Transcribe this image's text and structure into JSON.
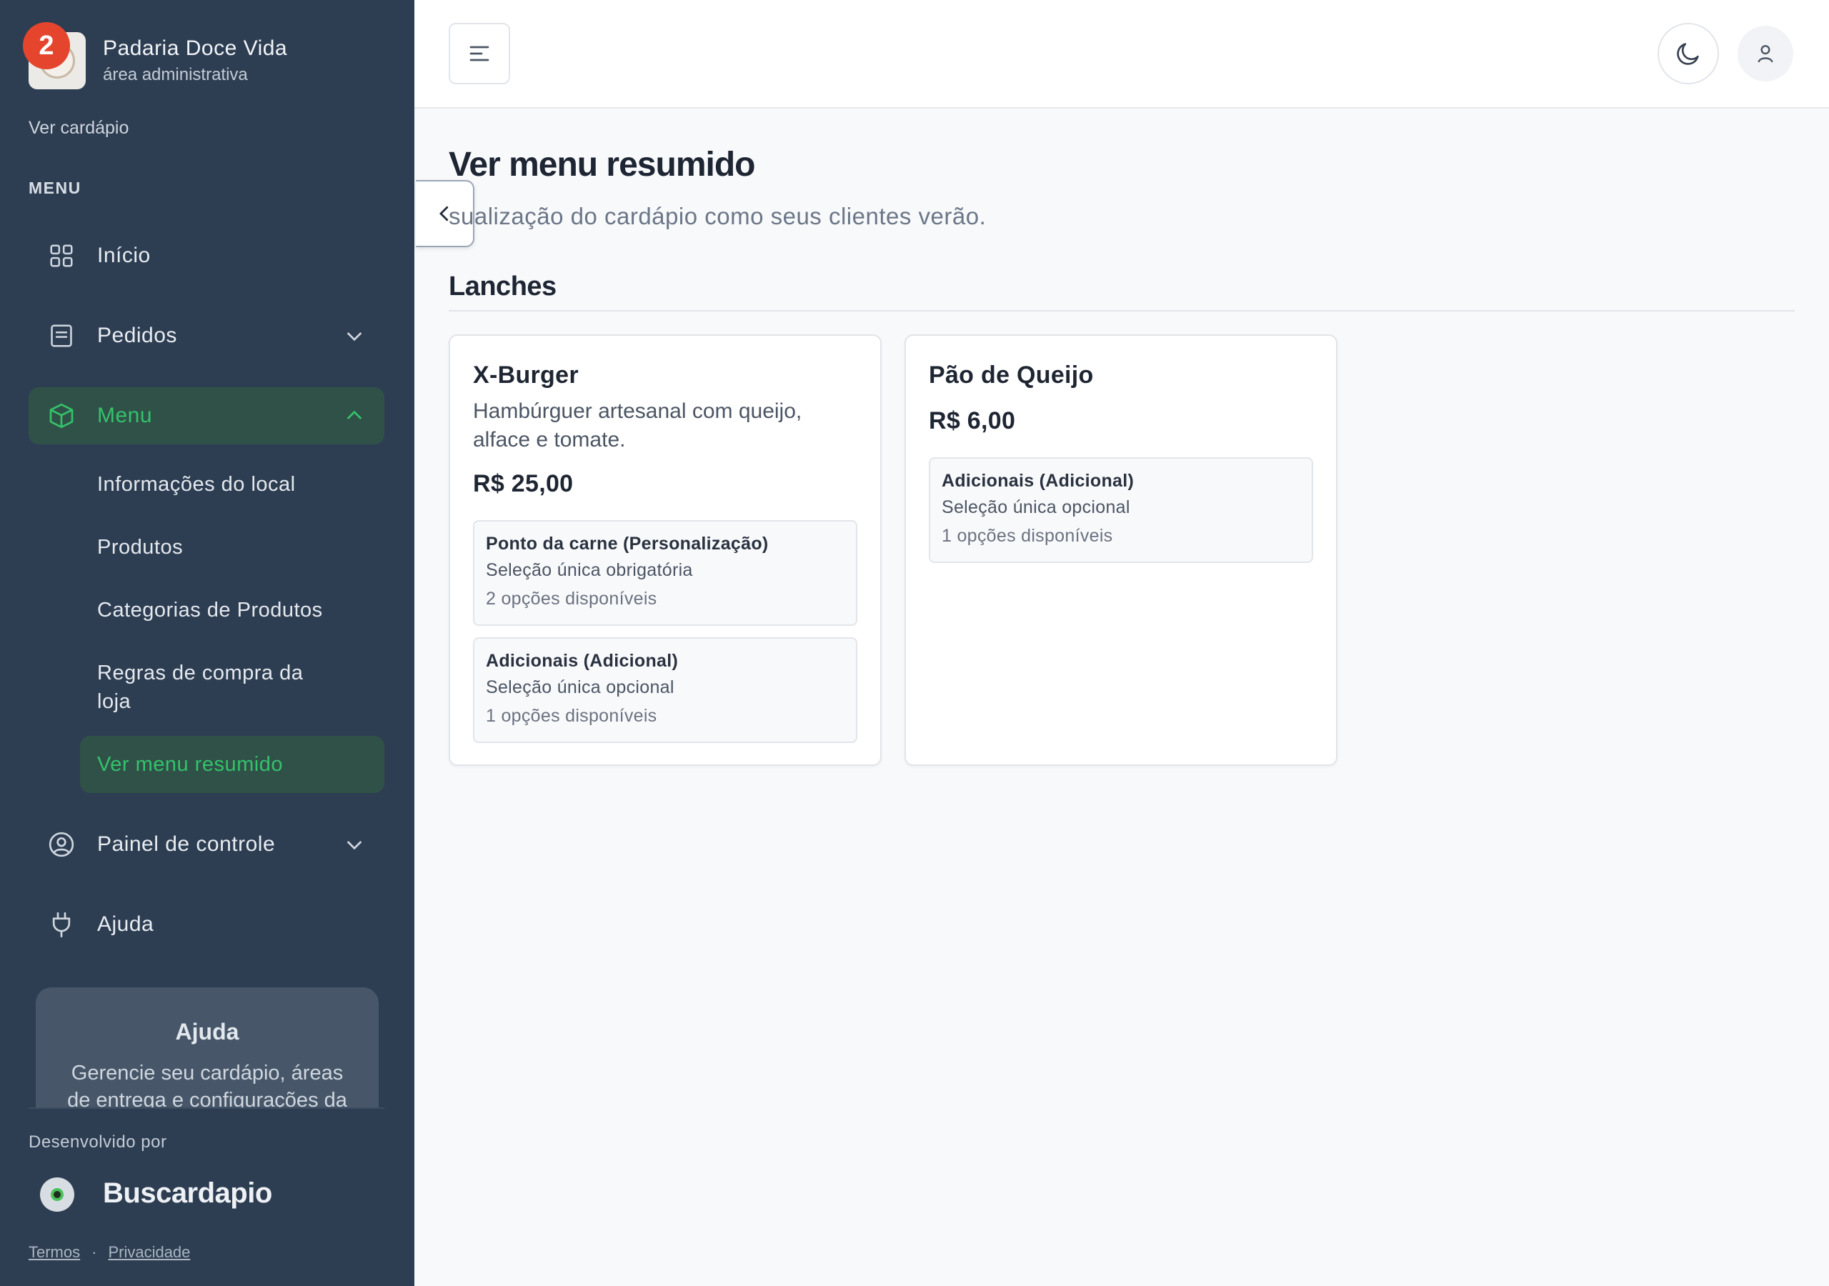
{
  "sidebar": {
    "notification_count": "2",
    "brand_name": "Padaria Doce Vida",
    "brand_sub": "área administrativa",
    "ver_cardapio": "Ver cardápio",
    "menu_heading": "MENU",
    "items": [
      {
        "label": "Início",
        "icon": "grid-icon"
      },
      {
        "label": "Pedidos",
        "icon": "receipt-icon"
      },
      {
        "label": "Menu",
        "icon": "box-icon"
      },
      {
        "label": "Painel de controle",
        "icon": "user-circle-icon"
      },
      {
        "label": "Ajuda",
        "icon": "plug-icon"
      }
    ],
    "menu_subitems": [
      "Informações do local",
      "Produtos",
      "Categorias de Produtos",
      "Regras de compra da loja",
      "Ver menu resumido"
    ],
    "help_card": {
      "title": "Ajuda",
      "text": "Gerencie seu cardápio, áreas de entrega e configurações da"
    },
    "developed_by": "Desenvolvido por",
    "developer_name": "Buscardapio",
    "terms": "Termos",
    "privacy": "Privacidade",
    "legal_separator": "·"
  },
  "main": {
    "title": "Ver menu resumido",
    "subtitle": "sualização do cardápio como seus clientes verão.",
    "section": "Lanches",
    "products": [
      {
        "name": "X-Burger",
        "description": "Hambúrguer artesanal com queijo, alface e tomate.",
        "price": "R$ 25,00",
        "options": [
          {
            "title": "Ponto da carne (Personalização)",
            "type": "Seleção única obrigatória",
            "count": "2 opções disponíveis"
          },
          {
            "title": "Adicionais (Adicional)",
            "type": "Seleção única opcional",
            "count": "1 opções disponíveis"
          }
        ]
      },
      {
        "name": "Pão de Queijo",
        "description": "",
        "price": "R$ 6,00",
        "options": [
          {
            "title": "Adicionais (Adicional)",
            "type": "Seleção única opcional",
            "count": "1 opções disponíveis"
          }
        ]
      }
    ]
  },
  "colors": {
    "sidebar_bg": "#2e3e52",
    "accent_green": "#34c26b",
    "active_bg": "#2f5148",
    "badge_red": "#e5452d"
  }
}
